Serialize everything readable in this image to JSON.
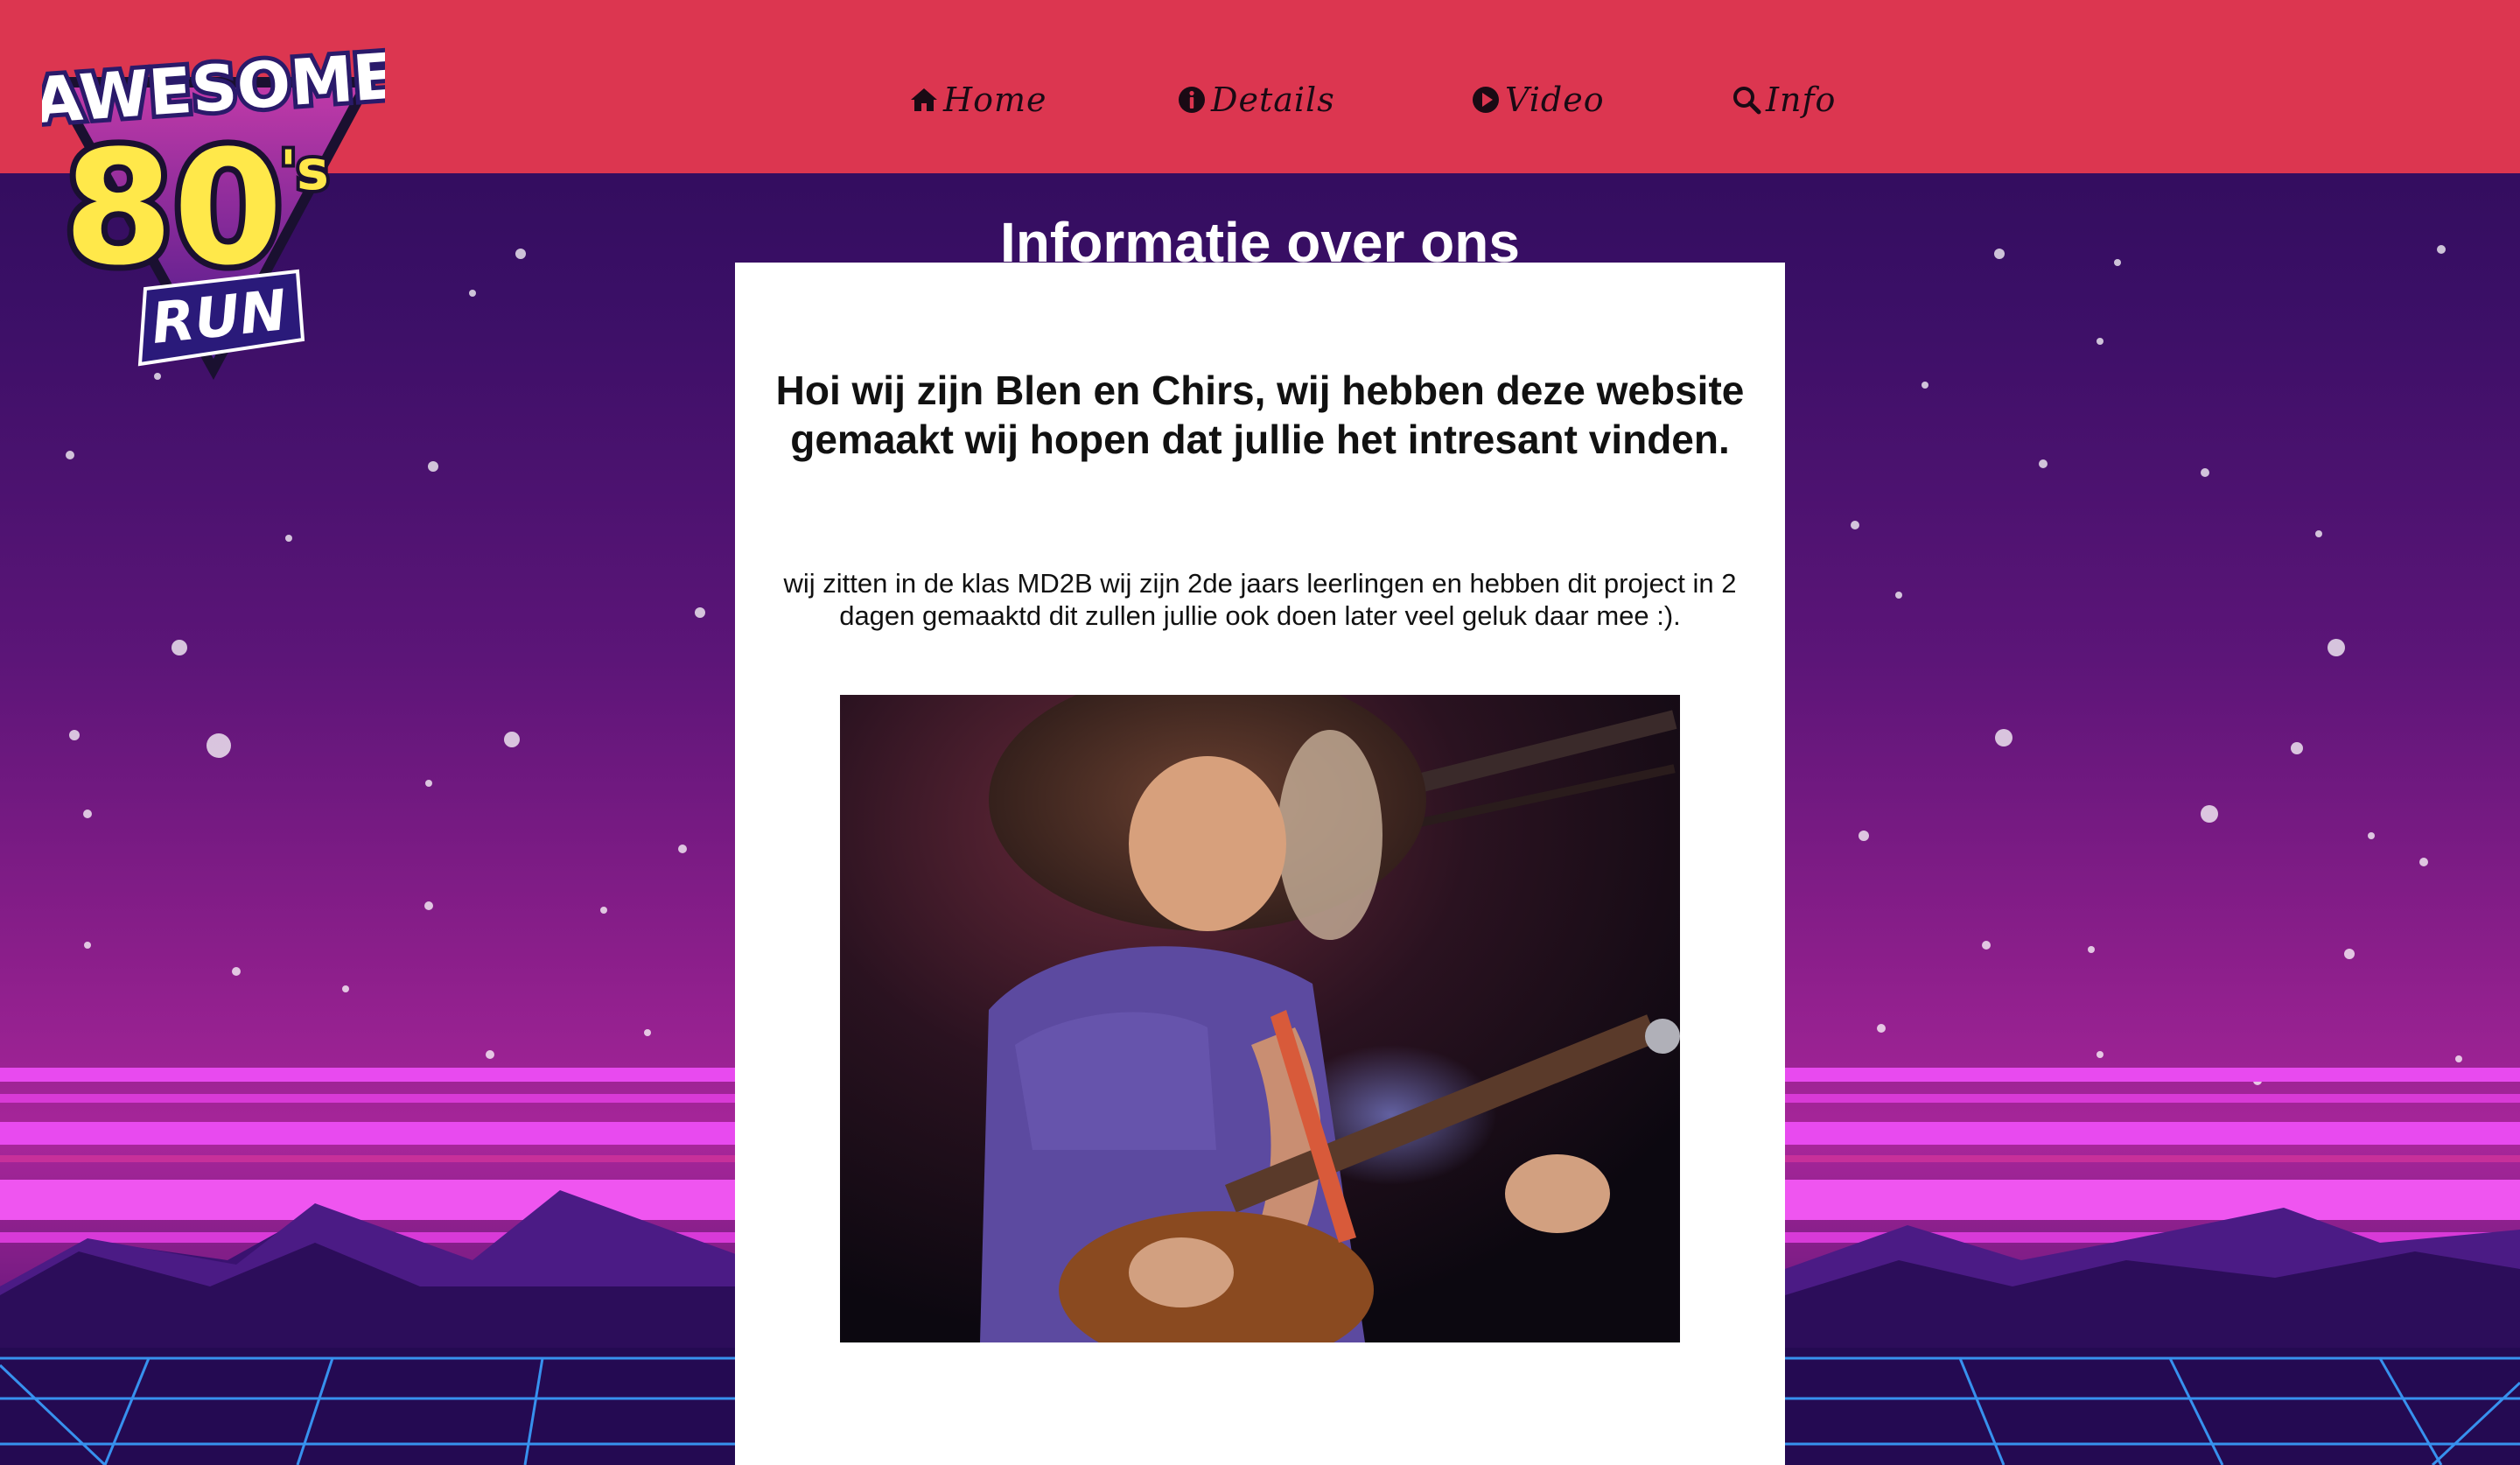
{
  "logo": {
    "line1": "AWESOME",
    "line2": "80",
    "line2_suffix": "'s",
    "line3": "RUN"
  },
  "nav": {
    "items": [
      {
        "label": "Home",
        "icon": "home-icon"
      },
      {
        "label": "Details",
        "icon": "info-circle-icon"
      },
      {
        "label": "Video",
        "icon": "play-circle-icon"
      },
      {
        "label": "Info",
        "icon": "search-icon"
      }
    ]
  },
  "main": {
    "title": "Informatie over ons",
    "heading": "Hoi wij zijn Blen en Chirs, wij hebben deze website gemaakt wij hopen dat jullie het intresant vinden.",
    "paragraph": "wij zitten in de klas MD2B wij zijn 2de jaars leerlingen en hebben dit project in 2 dagen gemaaktd dit zullen jullie ook doen later veel geluk daar mee :).",
    "media": "guitarist-gif"
  },
  "colors": {
    "header": "#dc3650",
    "bg_top": "#2a0a55",
    "bg_mid": "#8a1e8a",
    "stripe": "#e84aef",
    "grid": "#3aa0ff",
    "logo_yellow": "#ffe84a"
  }
}
